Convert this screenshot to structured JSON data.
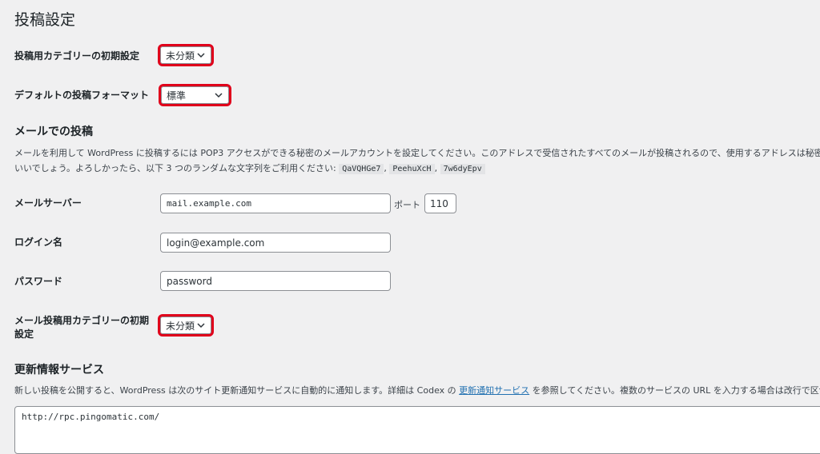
{
  "page_title": "投稿設定",
  "default_category": {
    "label": "投稿用カテゴリーの初期設定",
    "value": "未分類"
  },
  "default_format": {
    "label": "デフォルトの投稿フォーマット",
    "value": "標準"
  },
  "email_section": {
    "title": "メールでの投稿",
    "desc_line1": "メールを利用して WordPress に投稿するには POP3 アクセスができる秘密のメールアカウントを設定してください。このアドレスで受信されたすべてのメールが投稿されるので、使用するアドレスは秘密にして",
    "desc_line2_prefix": "いいでしょう。よろしかったら、以下 3 つのランダムな文字列をご利用ください:",
    "random_strings": [
      "QaVQHGe7",
      "PeehuXcH",
      "7w6dyEpv"
    ],
    "sep": ","
  },
  "mail_server": {
    "label": "メールサーバー",
    "value": "mail.example.com",
    "port_label": "ポート",
    "port_value": "110"
  },
  "login_name": {
    "label": "ログイン名",
    "value": "login@example.com"
  },
  "password": {
    "label": "パスワード",
    "value": "password"
  },
  "mail_category": {
    "label_line1": "メール投稿用カテゴリーの初期",
    "label_line2": "設定",
    "value": "未分類"
  },
  "update_services": {
    "title": "更新情報サービス",
    "desc_prefix": "新しい投稿を公開すると、WordPress は次のサイト更新通知サービスに自動的に通知します。詳細は Codex の",
    "link_text": "更新通知サービス",
    "desc_suffix": "を参照してください。複数のサービスの URL を入力する場合は改行で区切ります",
    "textarea_value": "http://rpc.pingomatic.com/"
  },
  "colors": {
    "highlight": "#e0001b",
    "link": "#2271b1",
    "background": "#f0f0f1"
  }
}
